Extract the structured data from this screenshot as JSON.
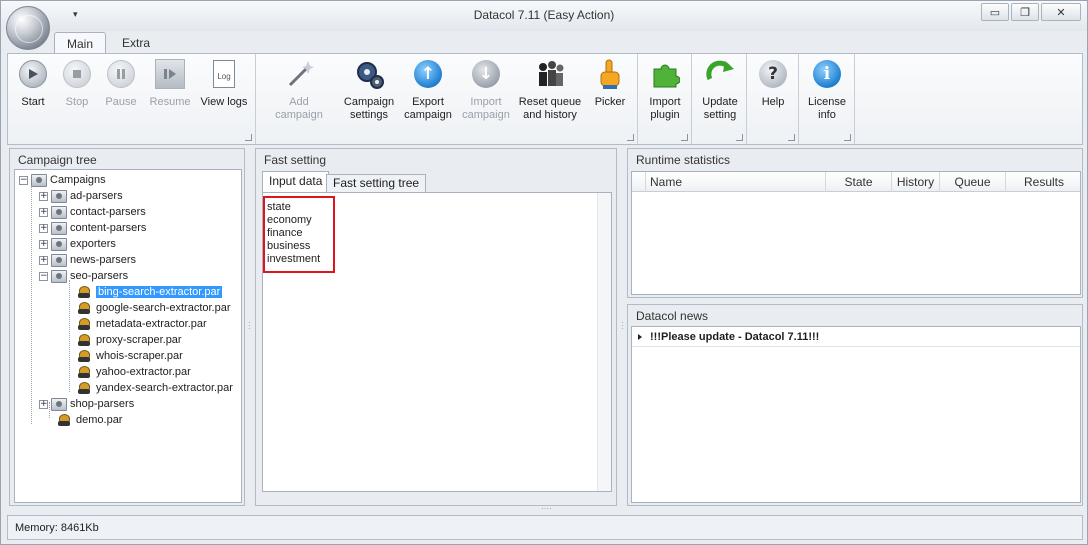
{
  "window": {
    "title": "Datacol 7.11 (Easy Action)",
    "qat_glyph": "▾",
    "minimize": "▭",
    "maximize": "❐",
    "close": "✕"
  },
  "ribbon_tabs": [
    "Main",
    "Extra"
  ],
  "ribbon": {
    "start": "Start",
    "stop": "Stop",
    "pause": "Pause",
    "resume": "Resume",
    "view_logs": "View logs",
    "add_campaign": "Add campaign",
    "campaign_settings": [
      "Campaign",
      "settings"
    ],
    "export_campaign": [
      "Export",
      "campaign"
    ],
    "import_campaign": [
      "Import",
      "campaign"
    ],
    "reset_queue": [
      "Reset queue",
      "and history"
    ],
    "picker": "Picker",
    "import_plugin": [
      "Import",
      "plugin"
    ],
    "update_setting": [
      "Update",
      "setting"
    ],
    "help": "Help",
    "license_info": [
      "License",
      "info"
    ],
    "log_icon_text": "Log"
  },
  "campaign_tree": {
    "title": "Campaign tree",
    "root": "Campaigns",
    "folders": [
      "ad-parsers",
      "contact-parsers",
      "content-parsers",
      "exporters",
      "news-parsers",
      "seo-parsers"
    ],
    "seo_children": [
      "bing-search-extractor.par",
      "google-search-extractor.par",
      "metadata-extractor.par",
      "proxy-scraper.par",
      "whois-scraper.par",
      "yahoo-extractor.par",
      "yandex-search-extractor.par"
    ],
    "after_folders": [
      "shop-parsers"
    ],
    "root_files": [
      "demo.par"
    ]
  },
  "fast_setting": {
    "title": "Fast setting",
    "tabs": [
      "Input data",
      "Fast setting tree"
    ],
    "lines": [
      "state",
      "economy",
      "finance",
      "business",
      "investment"
    ]
  },
  "runtime_statistics": {
    "title": "Runtime statistics",
    "columns": [
      "Name",
      "State",
      "History",
      "Queue",
      "Results"
    ]
  },
  "news": {
    "title": "Datacol news",
    "items": [
      "!!!Please update - Datacol 7.11!!!"
    ]
  },
  "status": {
    "memory": "Memory: 8461Kb"
  },
  "colors": {
    "accent_selection": "#3399ff",
    "highlight_box": "#e0141e"
  }
}
